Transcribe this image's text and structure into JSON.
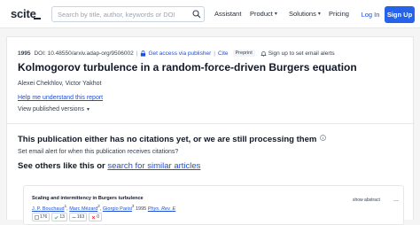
{
  "header": {
    "logo": "scite",
    "search_placeholder": "Search by title, author, keywords or DOI",
    "nav": {
      "assistant": "Assistant",
      "product": "Product",
      "solutions": "Solutions",
      "pricing": "Pricing",
      "login": "Log In",
      "signup": "Sign Up"
    }
  },
  "paper": {
    "year": "1995",
    "doi": "DOI: 10.48550/arxiv.adap-org/9506002",
    "access_link": "Get access via publisher",
    "cite": "Cite",
    "type_badge": "Preprint",
    "alerts_link": "Sign up to set email alerts",
    "title": "Kolmogorov turbulence in a random-force-driven Burgers equation",
    "authors": "Alexei Chekhlov, Victor Yakhot",
    "help_link": "Help me understand this report",
    "versions": "View published versions"
  },
  "citations": {
    "heading": "This publication either has no citations yet, or we are still processing them",
    "alert_label": "Set email alert for when this publication receives citations?",
    "see_others_prefix": "See others like this or ",
    "see_others_link": "search for similar articles"
  },
  "related": {
    "title": "Scaling and intermittency in Burgers turbulence",
    "authors": [
      {
        "name": "J. P. Bouchaud",
        "sup": "1"
      },
      {
        "name": "Marc Mézard",
        "sup": "2"
      },
      {
        "name": "Giorgio Parisi",
        "sup": "3"
      }
    ],
    "year": "1995",
    "journal": "Phys. Rev. E",
    "show_abstract": "show abstract",
    "more": "...",
    "badges": [
      {
        "icon": "citations-icon",
        "value": "176",
        "color": "#6b7280"
      },
      {
        "icon": "supporting-icon",
        "value": "13",
        "color": "#16a34a"
      },
      {
        "icon": "mentioning-icon",
        "value": "163",
        "color": "#6b7280"
      },
      {
        "icon": "contrasting-icon",
        "value": "0",
        "color": "#dc2626"
      }
    ]
  }
}
